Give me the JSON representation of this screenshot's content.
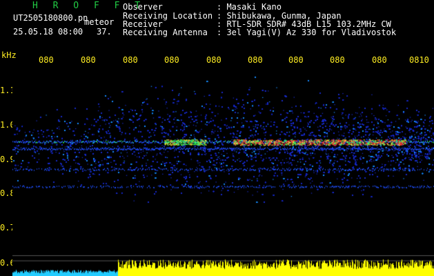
{
  "header": {
    "app_title": "H R O F F T",
    "filename": "UT2505180800.pn",
    "tag": "meteor",
    "datetime": "25.05.18 08:00",
    "datetime_suffix": "37.",
    "fields": [
      {
        "label": "Observer",
        "value": ": Masaki Kano"
      },
      {
        "label": "Receiving Location",
        "value": ": Shibukawa, Gunma, Japan"
      },
      {
        "label": "Receiver",
        "value": ": RTL-SDR SDR# 43dB L15 103.2MHz CW"
      },
      {
        "label": "Receiving Antenna",
        "value": ": 3el Yagi(V) Az 330 for Vladivostok"
      }
    ]
  },
  "axes": {
    "unit": "kHz",
    "x_ticks": [
      "080",
      "080",
      "080",
      "080",
      "080",
      "080",
      "080",
      "080",
      "080",
      "0810"
    ],
    "y_ticks": [
      "1.1",
      "1.0",
      "0.9",
      "0.8",
      "0.7",
      "0.6"
    ]
  },
  "spectrogram": {
    "freq_range_khz": [
      0.6,
      1.15
    ],
    "bands_khz": [
      0.95,
      0.93,
      0.87,
      0.82
    ],
    "colors": {
      "background": "#000000",
      "axis_text": "#ffee22",
      "signal_strong": "#ff3030",
      "signal_mid": "#30ff60",
      "signal_weak": "#2050ff",
      "level_bar": "#ffff00",
      "level_bar_low": "#22ccff"
    }
  }
}
